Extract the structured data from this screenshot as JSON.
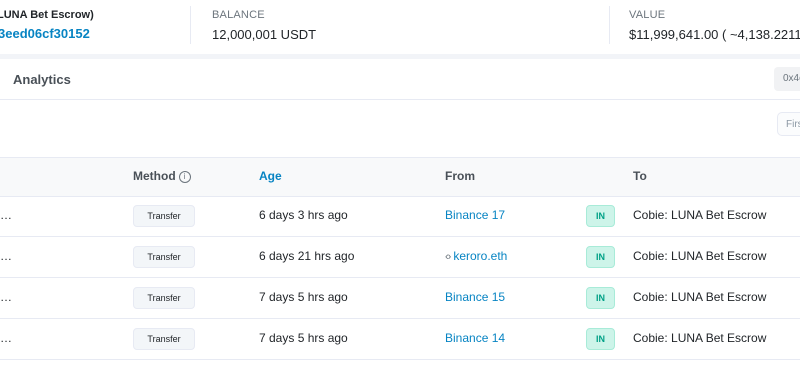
{
  "overview": {
    "contract_name": "LUNA Bet Escrow)",
    "address_fragment": "3eed06cf30152",
    "balance_label": "BALANCE",
    "balance_value": "12,000,001 USDT",
    "value_label": "VALUE",
    "value_value": "$11,999,641.00 ( ~4,138.2211"
  },
  "tabs": {
    "analytics": "Analytics",
    "address_chip": "0x4c"
  },
  "pagination": {
    "first": "First"
  },
  "table": {
    "headers": {
      "method": "Method",
      "age": "Age",
      "from": "From",
      "to": "To"
    },
    "info_icon": "i",
    "rows": [
      {
        "hash": "…",
        "method": "Transfer",
        "age": "6 days 3 hrs ago",
        "from": "Binance 17",
        "from_is_contract": false,
        "direction": "IN",
        "to": "Cobie: LUNA Bet Escrow"
      },
      {
        "hash": "…",
        "method": "Transfer",
        "age": "6 days 21 hrs ago",
        "from": "keroro.eth",
        "from_is_contract": true,
        "direction": "IN",
        "to": "Cobie: LUNA Bet Escrow"
      },
      {
        "hash": "…",
        "method": "Transfer",
        "age": "7 days 5 hrs ago",
        "from": "Binance 15",
        "from_is_contract": false,
        "direction": "IN",
        "to": "Cobie: LUNA Bet Escrow"
      },
      {
        "hash": "…",
        "method": "Transfer",
        "age": "7 days 5 hrs ago",
        "from": "Binance 14",
        "from_is_contract": false,
        "direction": "IN",
        "to": "Cobie: LUNA Bet Escrow"
      }
    ]
  },
  "icons": {
    "code": "code-icon",
    "info": "info-icon"
  },
  "colors": {
    "link": "#0784c3",
    "in_badge_bg": "#cdf4e9",
    "in_badge_text": "#00a186"
  }
}
